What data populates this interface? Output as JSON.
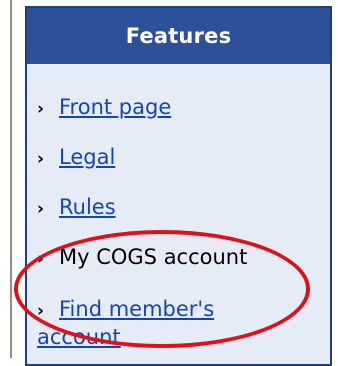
{
  "panel": {
    "title": "Features",
    "items": [
      {
        "label": "Front page",
        "link": true
      },
      {
        "label": "Legal",
        "link": true
      },
      {
        "label": "Rules",
        "link": true
      },
      {
        "label": "My COGS account",
        "link": false
      },
      {
        "label_line1": "Find member's",
        "label_line2": "account",
        "link": true
      }
    ]
  },
  "colors": {
    "header_bg": "#2c5199",
    "panel_bg": "#e6ecf7",
    "link": "#1446b0",
    "highlight_ring": "#e0101b"
  }
}
